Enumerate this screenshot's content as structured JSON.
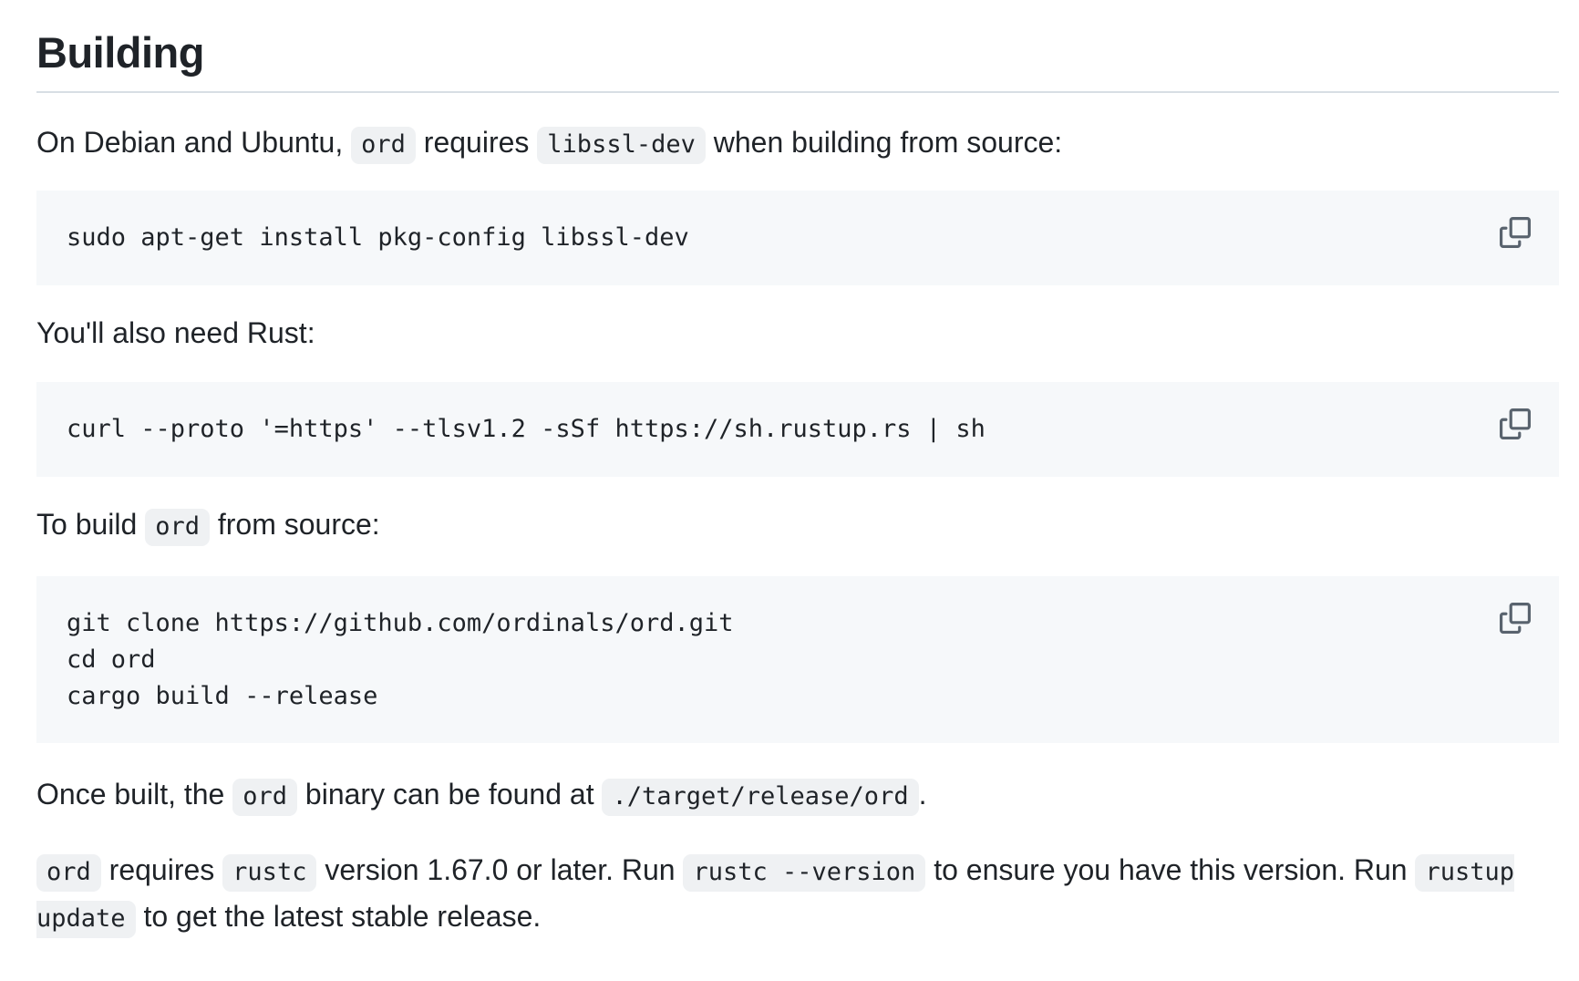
{
  "heading": "Building",
  "para1": {
    "t1": "On Debian and Ubuntu, ",
    "c1": "ord",
    "t2": " requires ",
    "c2": "libssl-dev",
    "t3": " when building from source:"
  },
  "code1": {
    "text": "sudo apt-get install pkg-config libssl-dev",
    "copy_icon": "copy-icon"
  },
  "para2": {
    "t1": "You'll also need Rust:"
  },
  "code2": {
    "text": "curl --proto '=https' --tlsv1.2 -sSf https://sh.rustup.rs | sh",
    "copy_icon": "copy-icon"
  },
  "para3": {
    "t1": "To build ",
    "c1": "ord",
    "t2": " from source:"
  },
  "code3": {
    "text": "git clone https://github.com/ordinals/ord.git\ncd ord\ncargo build --release",
    "copy_icon": "copy-icon"
  },
  "para4": {
    "t1": "Once built, the ",
    "c1": "ord",
    "t2": " binary can be found at ",
    "c2": "./target/release/ord",
    "t3": "."
  },
  "para5": {
    "c1": "ord",
    "t1": " requires ",
    "c2": "rustc",
    "t2": " version 1.67.0 or later. Run ",
    "c3": "rustc --version",
    "t3": " to ensure you have this version. Run ",
    "c4": "rustup update",
    "t4": " to get the latest stable release."
  },
  "colors": {
    "text": "#1f2328",
    "code_block_bg": "#f6f8fa",
    "inline_code_bg": "#eff1f3",
    "rule": "#d8dee4",
    "icon": "#59636e"
  }
}
